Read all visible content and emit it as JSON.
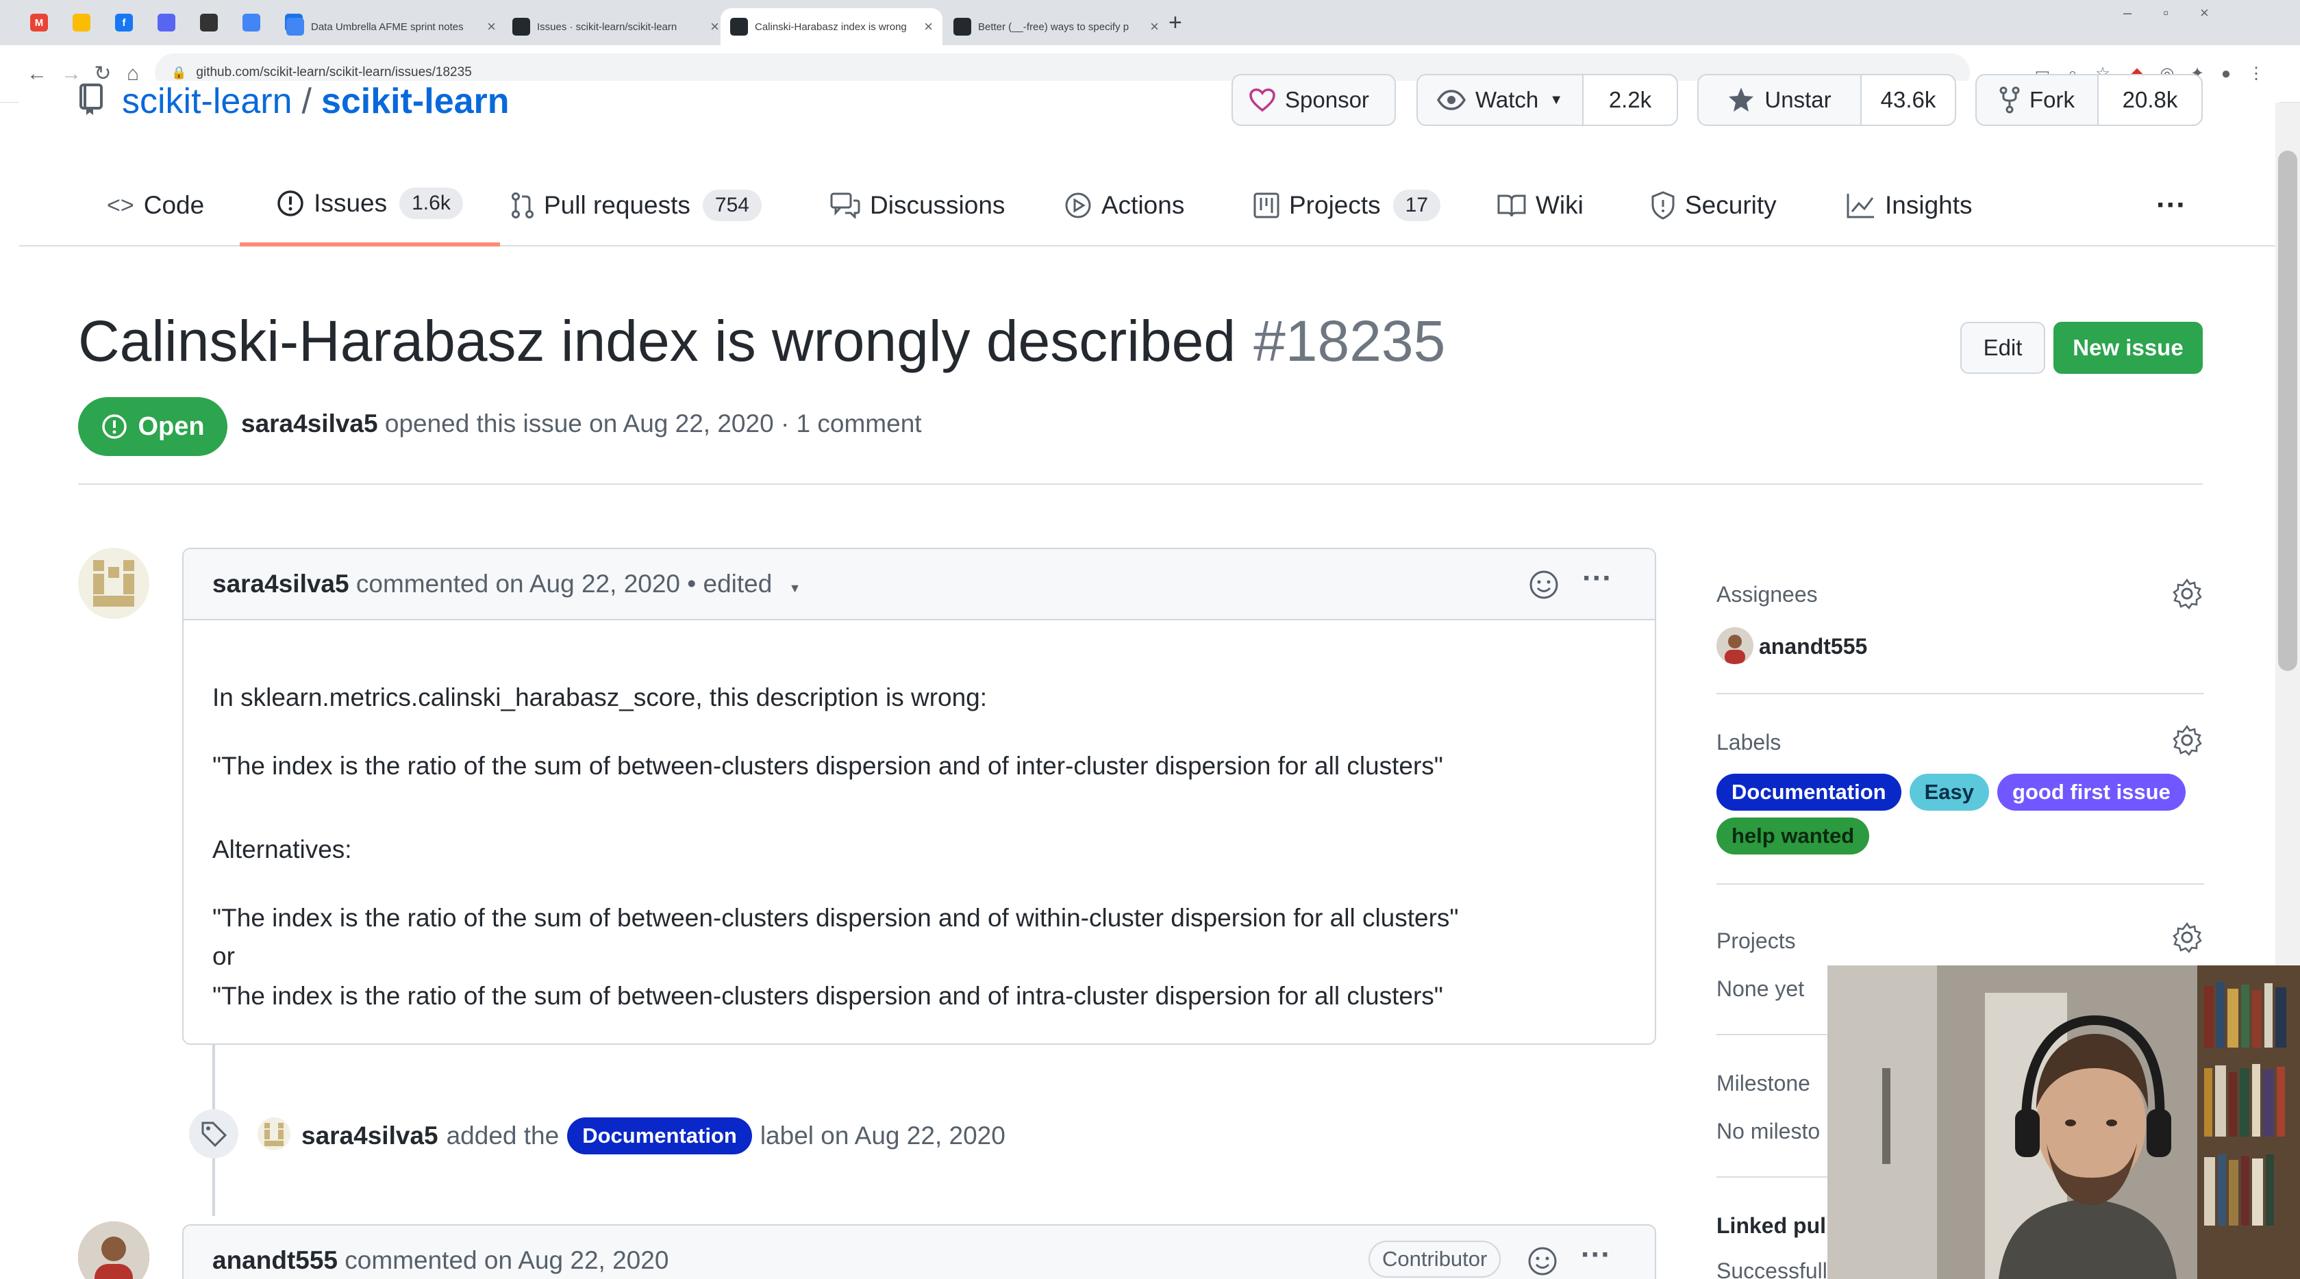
{
  "browser": {
    "tabs": [
      {
        "title": "Data Umbrella AFME sprint notes",
        "active": false
      },
      {
        "title": "Issues · scikit-learn/scikit-learn",
        "active": false
      },
      {
        "title": "Calinski-Harabasz index is wrong",
        "active": true
      },
      {
        "title": "Better (__-free) ways to specify p",
        "active": false
      }
    ],
    "new_tab": "+",
    "url": "github.com/scikit-learn/scikit-learn/issues/18235"
  },
  "repo": {
    "owner": "scikit-learn",
    "separator": "/",
    "name": "scikit-learn",
    "sponsor_label": "Sponsor",
    "watch_label": "Watch",
    "watch_count": "2.2k",
    "star_label": "Unstar",
    "star_count": "43.6k",
    "fork_label": "Fork",
    "fork_count": "20.8k"
  },
  "nav": {
    "code": "Code",
    "issues": "Issues",
    "issues_count": "1.6k",
    "pulls": "Pull requests",
    "pulls_count": "754",
    "discussions": "Discussions",
    "actions": "Actions",
    "projects": "Projects",
    "projects_count": "17",
    "wiki": "Wiki",
    "security": "Security",
    "insights": "Insights",
    "more": "···"
  },
  "issue": {
    "title": "Calinski-Harabasz index is wrongly described",
    "number": "#18235",
    "edit_label": "Edit",
    "new_issue_label": "New issue",
    "state": "Open",
    "author": "sara4silva5",
    "meta_rest": "opened this issue on Aug 22, 2020 · 1 comment"
  },
  "comment": {
    "author": "sara4silva5",
    "header_rest": "commented on Aug 22, 2020 • edited",
    "more": "···",
    "lines": [
      "In sklearn.metrics.calinski_harabasz_score, this description is wrong:",
      "\"The index is the ratio of the sum of between-clusters dispersion and of inter-cluster dispersion for all clusters\"",
      "Alternatives:",
      "\"The index is the ratio of the sum of between-clusters dispersion and of within-cluster dispersion for all clusters\"",
      "or",
      "\"The index is the ratio of the sum of between-clusters dispersion and of intra-cluster dispersion for all clusters\""
    ]
  },
  "event": {
    "author": "sara4silva5",
    "action": "added the",
    "label": "Documentation",
    "rest": "label on Aug 22, 2020"
  },
  "comment2": {
    "author": "anandt555",
    "header_rest": "commented on Aug 22, 2020",
    "badge": "Contributor",
    "more": "···"
  },
  "sidebar": {
    "assignees_heading": "Assignees",
    "assignee": "anandt555",
    "labels_heading": "Labels",
    "labels": [
      {
        "name": "Documentation",
        "bg": "#0a28c8",
        "fg": "#ffffff"
      },
      {
        "name": "Easy",
        "bg": "#5bc8dc",
        "fg": "#0b2f4a"
      },
      {
        "name": "good first issue",
        "bg": "#7057ff",
        "fg": "#ffffff"
      },
      {
        "name": "help wanted",
        "bg": "#2c9a3e",
        "fg": "#0a2a10"
      }
    ],
    "projects_heading": "Projects",
    "projects_value": "None yet",
    "milestone_heading": "Milestone",
    "milestone_value": "No milesto",
    "linked_heading": "Linked pull",
    "linked_value": "Successfully"
  },
  "colors": {
    "link": "#0969da",
    "open_green": "#2da44e",
    "active_tab_underline": "#fd8c73"
  }
}
